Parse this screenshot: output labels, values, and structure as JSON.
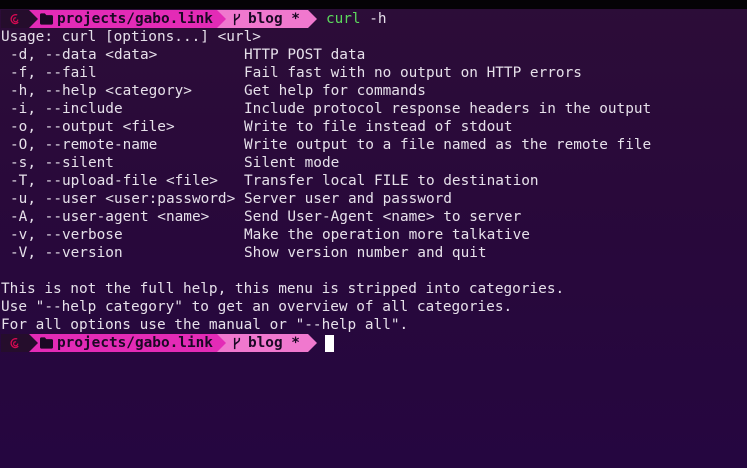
{
  "prompt": {
    "os_icon": "debian-icon",
    "folder_icon": "folder-icon",
    "branch_icon": "git-branch-icon",
    "path": "projects/gabo.link",
    "branch": "blog *",
    "colors": {
      "path_bg": "#e32bb6",
      "git_bg": "#f078ce",
      "os_bg": "#250d2c",
      "command": "#5cd85c"
    }
  },
  "command": {
    "name": "curl",
    "args": "-h"
  },
  "output": {
    "usage": "Usage: curl [options...] <url>",
    "options": [
      {
        "flag": "-d, --data <data>",
        "desc": "HTTP POST data"
      },
      {
        "flag": "-f, --fail",
        "desc": "Fail fast with no output on HTTP errors"
      },
      {
        "flag": "-h, --help <category>",
        "desc": "Get help for commands"
      },
      {
        "flag": "-i, --include",
        "desc": "Include protocol response headers in the output"
      },
      {
        "flag": "-o, --output <file>",
        "desc": "Write to file instead of stdout"
      },
      {
        "flag": "-O, --remote-name",
        "desc": "Write output to a file named as the remote file"
      },
      {
        "flag": "-s, --silent",
        "desc": "Silent mode"
      },
      {
        "flag": "-T, --upload-file <file>",
        "desc": "Transfer local FILE to destination"
      },
      {
        "flag": "-u, --user <user:password>",
        "desc": "Server user and password"
      },
      {
        "flag": "-A, --user-agent <name>",
        "desc": "Send User-Agent <name> to server"
      },
      {
        "flag": "-v, --verbose",
        "desc": "Make the operation more talkative"
      },
      {
        "flag": "-V, --version",
        "desc": "Show version number and quit"
      }
    ],
    "footer": [
      "This is not the full help, this menu is stripped into categories.",
      "Use \"--help category\" to get an overview of all categories.",
      "For all options use the manual or \"--help all\"."
    ]
  }
}
